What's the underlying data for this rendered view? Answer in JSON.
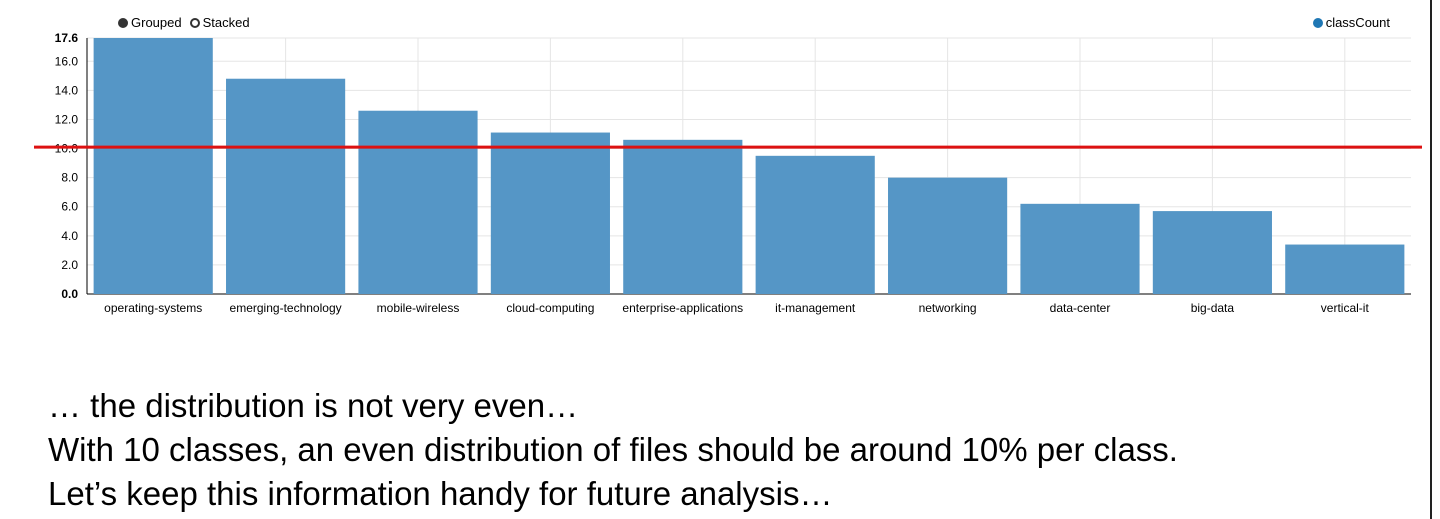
{
  "controls": {
    "grouped_label": "Grouped",
    "stacked_label": "Stacked",
    "selected": "grouped"
  },
  "legend": {
    "series_label": "classCount",
    "color": "#1f77b4"
  },
  "colors": {
    "bar": "#5596c6",
    "reference_line": "#dd1111",
    "grid": "#e5e5e5"
  },
  "chart_data": {
    "type": "bar",
    "categories": [
      "operating-systems",
      "emerging-technology",
      "mobile-wireless",
      "cloud-computing",
      "enterprise-applications",
      "it-management",
      "networking",
      "data-center",
      "big-data",
      "vertical-it"
    ],
    "series": [
      {
        "name": "classCount",
        "values": [
          17.6,
          14.8,
          12.6,
          11.1,
          10.6,
          9.5,
          8.0,
          6.2,
          5.7,
          3.4
        ]
      }
    ],
    "ylim": [
      0,
      17.6
    ],
    "yticks": [
      "0.0",
      "2.0",
      "4.0",
      "6.0",
      "8.0",
      "10.0",
      "12.0",
      "14.0",
      "16.0",
      "17.6"
    ],
    "reference_line": {
      "y": 10.1
    },
    "grid": true,
    "legend_position": "top-right",
    "title": "",
    "xlabel": "",
    "ylabel": ""
  },
  "caption": {
    "lines": [
      "… the distribution is not very even…",
      "With 10 classes, an even distribution of files should be around 10% per class.",
      "Let’s keep this information handy for future analysis…"
    ]
  }
}
